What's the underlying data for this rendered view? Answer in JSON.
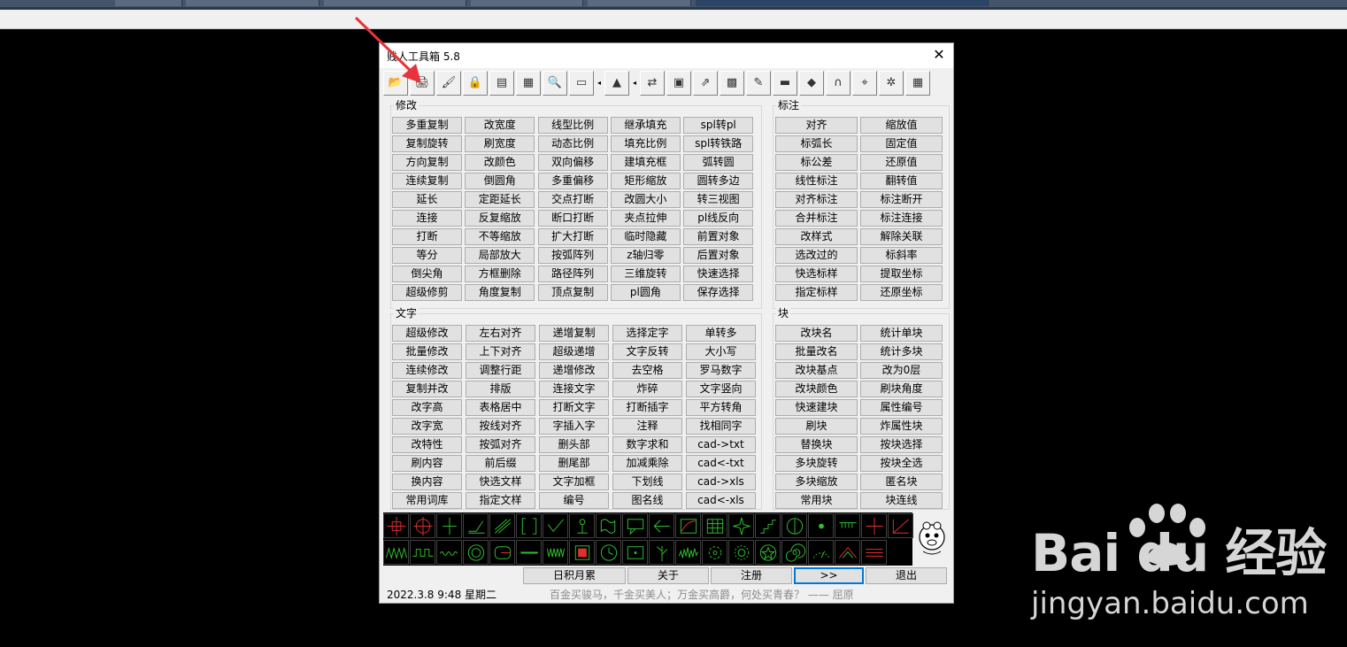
{
  "window": {
    "title": "贱人工具箱 5.8",
    "close_glyph": "✕"
  },
  "toolbar": {
    "icons": [
      "open-folder-icon",
      "print-icon",
      "brush-icon",
      "lock-icon",
      "wmf-icon",
      "window-icon",
      "magnifier-icon",
      "measure-icon",
      "layer-icon",
      "exchange-icon",
      "block-reference-icon",
      "shortcut-icon",
      "color-grid-icon",
      "edit-note-icon",
      "display-icon",
      "eraser-icon",
      "magnet-icon",
      "snap-icon",
      "gear-icon",
      "calculator-icon"
    ],
    "glyphs": [
      "📂",
      "🖨",
      "🖌",
      "🔒",
      "▤",
      "▦",
      "🔍",
      "▭",
      "▲",
      "⇄",
      "▣",
      "⇗",
      "▩",
      "✎",
      "▬",
      "◆",
      "∩",
      "⌖",
      "✲",
      "▦"
    ],
    "small_arrows": [
      "◂",
      "◂"
    ]
  },
  "modify": {
    "label": "修改",
    "rows": [
      [
        "多重复制",
        "改宽度",
        "线型比例",
        "继承填充",
        "spl转pl"
      ],
      [
        "复制旋转",
        "刷宽度",
        "动态比例",
        "填充比例",
        "spl转铁路"
      ],
      [
        "方向复制",
        "改颜色",
        "双向偏移",
        "建填充框",
        "弧转圆"
      ],
      [
        "连续复制",
        "倒圆角",
        "多重偏移",
        "矩形缩放",
        "圆转多边"
      ],
      [
        "延长",
        "定距延长",
        "交点打断",
        "改圆大小",
        "转三视图"
      ],
      [
        "连接",
        "反复缩放",
        "断口打断",
        "夹点拉伸",
        "pl线反向"
      ],
      [
        "打断",
        "不等缩放",
        "扩大打断",
        "临时隐藏",
        "前置对象"
      ],
      [
        "等分",
        "局部放大",
        "按弧阵列",
        "z轴归零",
        "后置对象"
      ],
      [
        "倒尖角",
        "方框删除",
        "路径阵列",
        "三维旋转",
        "快速选择"
      ],
      [
        "超级修剪",
        "角度复制",
        "顶点复制",
        "pl圆角",
        "保存选择"
      ]
    ]
  },
  "dimension": {
    "label": "标注",
    "rows": [
      [
        "对齐",
        "缩放值"
      ],
      [
        "标弧长",
        "固定值"
      ],
      [
        "标公差",
        "还原值"
      ],
      [
        "线性标注",
        "翻转值"
      ],
      [
        "对齐标注",
        "标注断开"
      ],
      [
        "合并标注",
        "标注连接"
      ],
      [
        "改样式",
        "解除关联"
      ],
      [
        "选改过的",
        "标斜率"
      ],
      [
        "快选标样",
        "提取坐标"
      ],
      [
        "指定标样",
        "还原坐标"
      ]
    ]
  },
  "text": {
    "label": "文字",
    "rows": [
      [
        "超级修改",
        "左右对齐",
        "递增复制",
        "选择定字",
        "单转多"
      ],
      [
        "批量修改",
        "上下对齐",
        "超级递增",
        "文字反转",
        "大小写"
      ],
      [
        "连续修改",
        "调整行距",
        "递增修改",
        "去空格",
        "罗马数字"
      ],
      [
        "复制并改",
        "排版",
        "连接文字",
        "炸碎",
        "文字竖向"
      ],
      [
        "改字高",
        "表格居中",
        "打断文字",
        "打断插字",
        "平方转角"
      ],
      [
        "改字宽",
        "按线对齐",
        "字插入字",
        "注释",
        "找相同字"
      ],
      [
        "改特性",
        "按弧对齐",
        "删头部",
        "数字求和",
        "cad->txt"
      ],
      [
        "刷内容",
        "前后缀",
        "删尾部",
        "加减乘除",
        "cad<-txt"
      ],
      [
        "换内容",
        "快选文样",
        "文字加框",
        "下划线",
        "cad->xls"
      ],
      [
        "常用词库",
        "指定文样",
        "编号",
        "图名线",
        "cad<-xls"
      ]
    ]
  },
  "block": {
    "label": "块",
    "rows": [
      [
        "改块名",
        "统计单块"
      ],
      [
        "批量改名",
        "统计多块"
      ],
      [
        "改块基点",
        "改为0层"
      ],
      [
        "改块颜色",
        "刷块角度"
      ],
      [
        "快速建块",
        "属性编号"
      ],
      [
        "刷块",
        "炸属性块"
      ],
      [
        "替换块",
        "按块选择"
      ],
      [
        "多块旋转",
        "按块全选"
      ],
      [
        "多块缩放",
        "匿名块"
      ],
      [
        "常用块",
        "块连线"
      ]
    ]
  },
  "symbols": {
    "row1": [
      "crosshair-icon",
      "circle-cross-icon",
      "axis-icon",
      "slope-icon",
      "hatch-icon",
      "bracket-icon",
      "check-slope-icon",
      "anchor-icon",
      "wave-box-icon",
      "callout-icon",
      "arrow-left-icon",
      "curve-box-icon",
      "grid-table-icon",
      "star-burst-icon",
      "stairs-icon",
      "circle-split-icon",
      "dot-icon",
      "comb-icon",
      "cross-icon",
      "diagonal-box-icon"
    ],
    "row2": [
      "zigzag-icon",
      "square-wave-icon",
      "small-wave-icon",
      "target-icon",
      "rounded-rect-icon",
      "line-icon",
      "spring-icon",
      "filled-square-icon",
      "clock-icon",
      "boxed-dot-icon",
      "plant-icon",
      "noise-icon",
      "gear-outline-icon",
      "gear-filled-icon",
      "star-circle-icon",
      "spiral-icon",
      "arc-icon",
      "chevron-roof-icon",
      "triple-line-icon"
    ]
  },
  "bottom": {
    "buttons": [
      "日积月累",
      "关于",
      "注册",
      ">>",
      "退出"
    ],
    "date": "2022.3.8   9:48   星期二",
    "quote": "百金买骏马，千金买美人；万金买高爵，何处买青春？ —— 屈原"
  },
  "watermark": {
    "brand": "Bai du 经验",
    "url": "jingyan.baidu.com"
  },
  "colors": {
    "window_bg": "#f0f0f0",
    "button_face": "#e1e1e1",
    "button_border": "#adadad",
    "annotation_arrow": "#e8333c",
    "symbol_red": "#e03030",
    "symbol_green": "#2fbf2f"
  }
}
